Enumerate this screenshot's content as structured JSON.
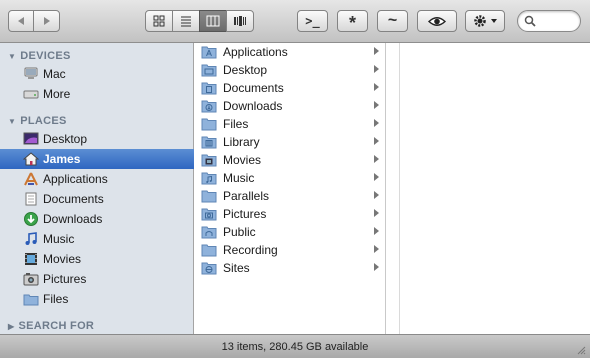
{
  "toolbar": {
    "back_icon": "back-arrow-icon",
    "forward_icon": "forward-arrow-icon",
    "view_modes": [
      "icon-view",
      "list-view",
      "column-view",
      "cover-flow-view"
    ],
    "active_view": "column-view",
    "terminal_label": ">_",
    "star_label": "*",
    "tilde_label": "~",
    "quicklook_icon": "eye-icon",
    "action_icon": "gear-icon",
    "search_placeholder": ""
  },
  "sidebar": {
    "devices_header": "DEVICES",
    "devices": [
      {
        "label": "Mac",
        "icon": "computer-icon"
      },
      {
        "label": "More",
        "icon": "drive-icon"
      }
    ],
    "places_header": "PLACES",
    "places": [
      {
        "label": "Desktop",
        "icon": "desktop-icon"
      },
      {
        "label": "James",
        "icon": "home-icon",
        "selected": true
      },
      {
        "label": "Applications",
        "icon": "applications-icon"
      },
      {
        "label": "Documents",
        "icon": "documents-icon"
      },
      {
        "label": "Downloads",
        "icon": "downloads-icon"
      },
      {
        "label": "Music",
        "icon": "music-icon"
      },
      {
        "label": "Movies",
        "icon": "movies-icon"
      },
      {
        "label": "Pictures",
        "icon": "pictures-icon"
      },
      {
        "label": "Files",
        "icon": "folder-icon"
      }
    ],
    "search_header": "SEARCH FOR"
  },
  "column": {
    "items": [
      "Applications",
      "Desktop",
      "Documents",
      "Downloads",
      "Files",
      "Library",
      "Movies",
      "Music",
      "Parallels",
      "Pictures",
      "Public",
      "Recording",
      "Sites"
    ]
  },
  "status": {
    "text": "13 items, 280.45 GB available"
  },
  "colors": {
    "selection": "#3d74c9",
    "sidebar_bg": "#dde3ea",
    "section_header": "#6e7b8b",
    "folder": "#8fb2db"
  }
}
